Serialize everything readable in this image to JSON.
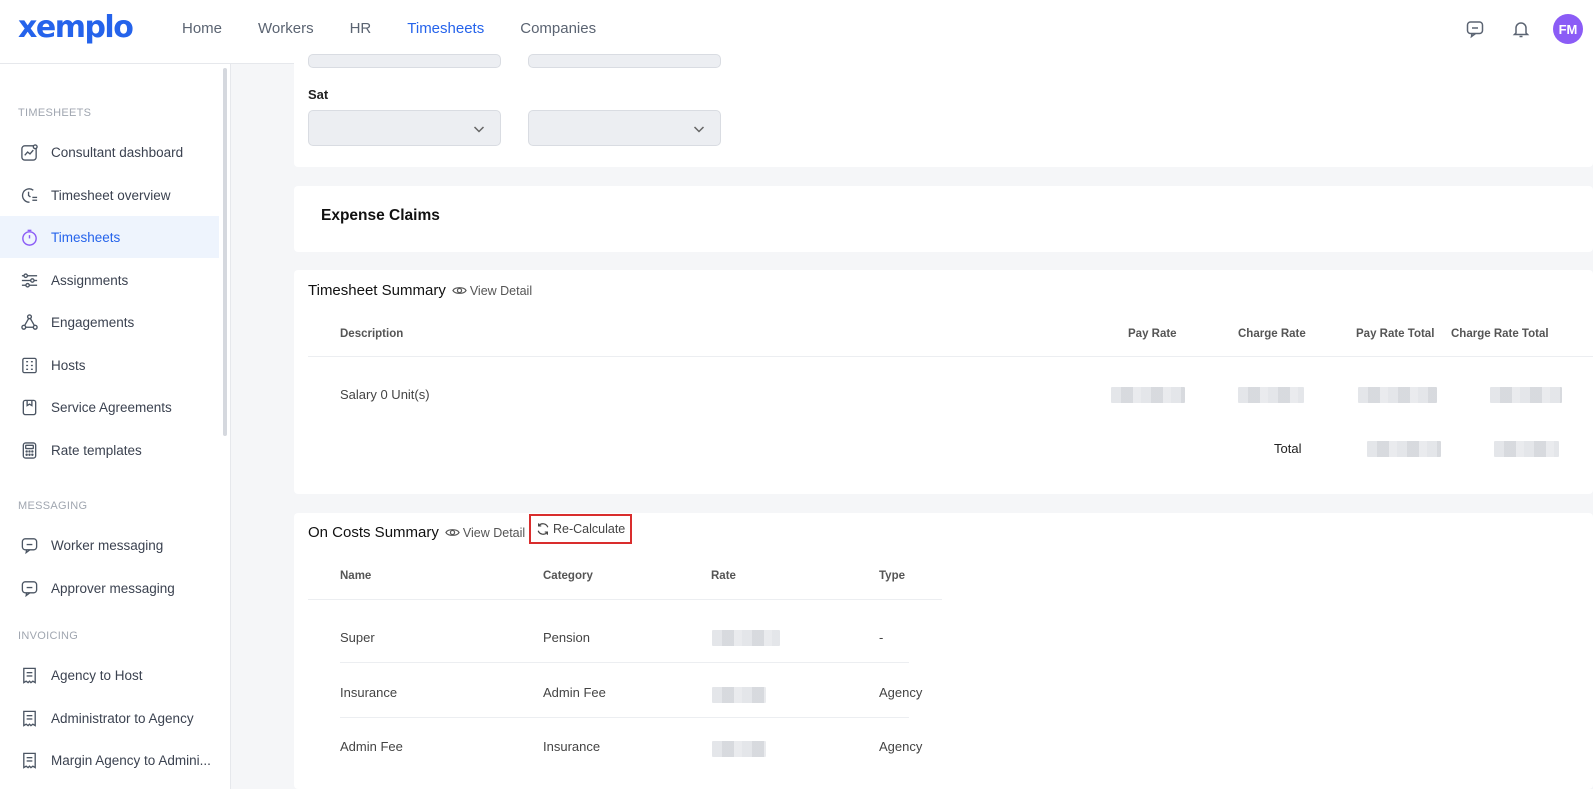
{
  "app": {
    "logo": "xemplo"
  },
  "nav": {
    "items": [
      {
        "label": "Home"
      },
      {
        "label": "Workers"
      },
      {
        "label": "HR"
      },
      {
        "label": "Timesheets"
      },
      {
        "label": "Companies"
      }
    ],
    "active": "Timesheets"
  },
  "user": {
    "initials": "FM"
  },
  "sidebar": {
    "sections": [
      {
        "title": "TIMESHEETS"
      },
      {
        "title": "MESSAGING"
      },
      {
        "title": "INVOICING"
      }
    ],
    "items": [
      {
        "label": "Consultant dashboard",
        "icon": "chart-icon"
      },
      {
        "label": "Timesheet overview",
        "icon": "clock-list-icon"
      },
      {
        "label": "Timesheets",
        "icon": "timer-icon"
      },
      {
        "label": "Assignments",
        "icon": "sliders-icon"
      },
      {
        "label": "Engagements",
        "icon": "network-icon"
      },
      {
        "label": "Hosts",
        "icon": "building-icon"
      },
      {
        "label": "Service Agreements",
        "icon": "bookmark-icon"
      },
      {
        "label": "Rate templates",
        "icon": "calculator-icon"
      },
      {
        "label": "Worker messaging",
        "icon": "message-icon"
      },
      {
        "label": "Approver messaging",
        "icon": "message-icon"
      },
      {
        "label": "Agency to Host",
        "icon": "invoice-icon"
      },
      {
        "label": "Administrator to Agency",
        "icon": "invoice-icon"
      },
      {
        "label": "Margin Agency to Admini...",
        "icon": "invoice-icon"
      }
    ]
  },
  "days": {
    "sat_label": "Sat"
  },
  "expense": {
    "title": "Expense Claims"
  },
  "timesheet_summary": {
    "title": "Timesheet Summary",
    "view_detail": "View Detail",
    "columns": [
      "Description",
      "Pay Rate",
      "Charge Rate",
      "Pay Rate Total",
      "Charge Rate Total"
    ],
    "rows": [
      {
        "description": "Salary 0 Unit(s)"
      }
    ],
    "total_label": "Total"
  },
  "on_costs": {
    "title": "On Costs Summary",
    "view_detail": "View Detail",
    "recalculate": "Re-Calculate",
    "columns": [
      "Name",
      "Category",
      "Rate",
      "Type"
    ],
    "rows": [
      {
        "name": "Super",
        "category": "Pension",
        "type": "-"
      },
      {
        "name": "Insurance",
        "category": "Admin Fee",
        "type": "Agency"
      },
      {
        "name": "Admin Fee",
        "category": "Insurance",
        "type": "Agency"
      }
    ]
  },
  "colors": {
    "accent": "#2563eb",
    "highlight_border": "#d92d2d",
    "avatar": "#8b5cf6"
  }
}
